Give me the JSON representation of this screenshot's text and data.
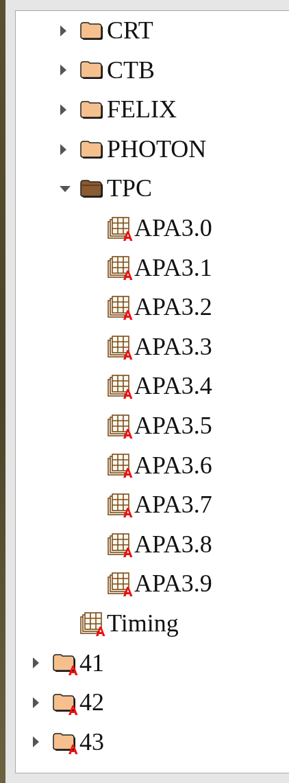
{
  "tree": {
    "items": [
      {
        "children": [
          {
            "label": "CRT",
            "kind": "folder",
            "expanded": false,
            "marked": false
          },
          {
            "label": "CTB",
            "kind": "folder",
            "expanded": false,
            "marked": false
          },
          {
            "label": "FELIX",
            "kind": "folder",
            "expanded": false,
            "marked": false
          },
          {
            "label": "PHOTON",
            "kind": "folder",
            "expanded": false,
            "marked": false
          },
          {
            "label": "TPC",
            "kind": "folder",
            "expanded": true,
            "marked": false,
            "children": [
              {
                "label": "APA3.0",
                "kind": "component",
                "marked": true
              },
              {
                "label": "APA3.1",
                "kind": "component",
                "marked": true
              },
              {
                "label": "APA3.2",
                "kind": "component",
                "marked": true
              },
              {
                "label": "APA3.3",
                "kind": "component",
                "marked": true
              },
              {
                "label": "APA3.4",
                "kind": "component",
                "marked": true
              },
              {
                "label": "APA3.5",
                "kind": "component",
                "marked": true
              },
              {
                "label": "APA3.6",
                "kind": "component",
                "marked": true
              },
              {
                "label": "APA3.7",
                "kind": "component",
                "marked": true
              },
              {
                "label": "APA3.8",
                "kind": "component",
                "marked": true
              },
              {
                "label": "APA3.9",
                "kind": "component",
                "marked": true
              }
            ]
          },
          {
            "label": "Timing",
            "kind": "component",
            "marked": true
          }
        ]
      },
      {
        "label": "41",
        "kind": "folder",
        "expanded": false,
        "marked": true
      },
      {
        "label": "42",
        "kind": "folder",
        "expanded": false,
        "marked": true
      },
      {
        "label": "43",
        "kind": "folder",
        "expanded": false,
        "marked": true
      }
    ]
  }
}
